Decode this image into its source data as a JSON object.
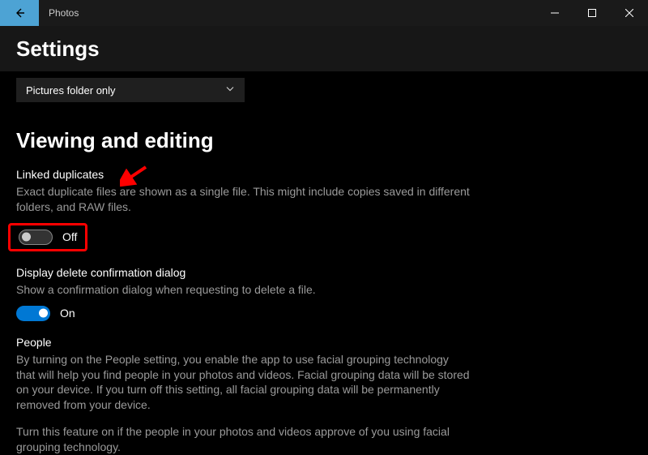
{
  "titlebar": {
    "app_name": "Photos"
  },
  "header": {
    "title": "Settings"
  },
  "dropdown": {
    "selected": "Pictures folder only"
  },
  "section": {
    "heading": "Viewing and editing"
  },
  "linked_duplicates": {
    "title": "Linked duplicates",
    "desc": "Exact duplicate files are shown as a single file. This might include copies saved in different folders, and RAW files.",
    "state_label": "Off"
  },
  "delete_confirm": {
    "title": "Display delete confirmation dialog",
    "desc": "Show a confirmation dialog when requesting to delete a file.",
    "state_label": "On"
  },
  "people": {
    "title": "People",
    "desc": "By turning on the People setting, you enable the app to use facial grouping technology that will help you find people in your photos and videos. Facial grouping data will be stored on your device. If you turn off this setting, all facial grouping data will be permanently removed from your device.",
    "desc2": "Turn this feature on if the people in your photos and videos approve of you using facial grouping technology."
  },
  "annotation": {
    "highlight_color": "#ff0000"
  }
}
